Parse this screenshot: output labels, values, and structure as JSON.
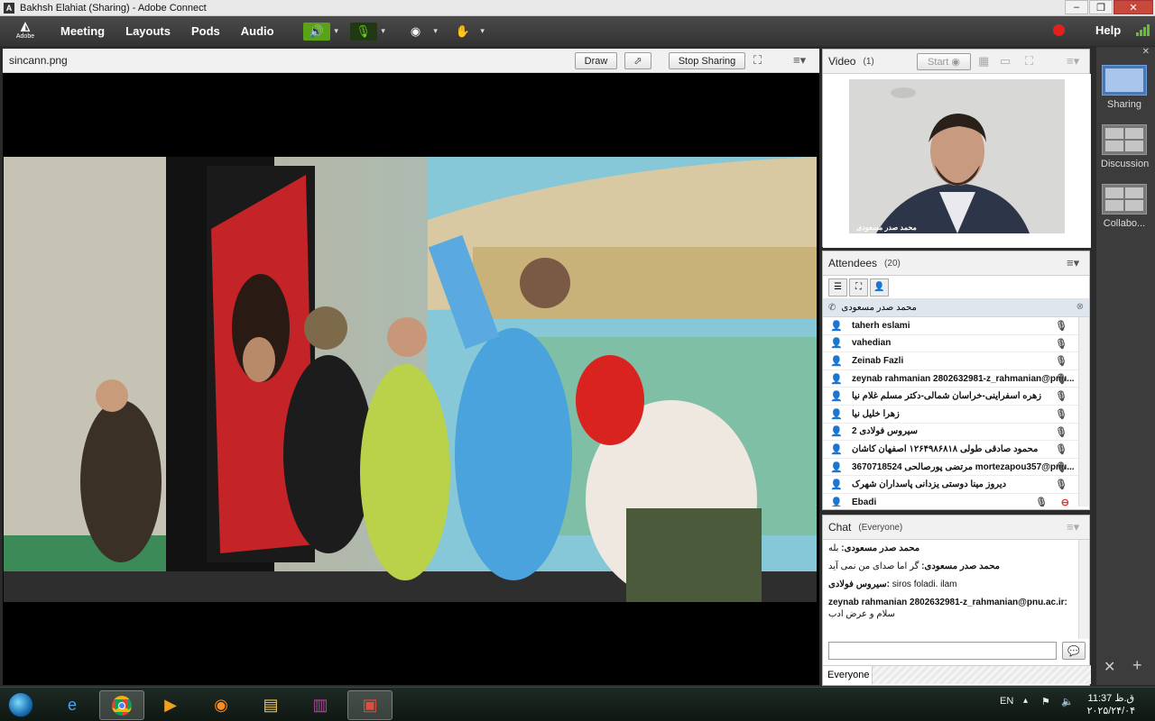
{
  "window": {
    "title": "Bakhsh Elahiat (Sharing) - Adobe Connect",
    "controls": [
      "–",
      "❐",
      "✕"
    ]
  },
  "menubar": {
    "logo": "Adobe",
    "items": [
      "Meeting",
      "Layouts",
      "Pods",
      "Audio"
    ],
    "help": "Help",
    "accent": "#6bd11f"
  },
  "share_pod": {
    "title": "sincann.png",
    "draw_label": "Draw",
    "stop_sharing_label": "Stop Sharing",
    "menu_icon": "≡▾"
  },
  "video_pod": {
    "title": "Video",
    "count": "(1)",
    "start_label": "Start",
    "name_tag": "محمد صدر مسعودی"
  },
  "attendees_pod": {
    "title": "Attendees",
    "count": "(20)",
    "host": "محمد صدر مسعودی",
    "rows": [
      "taherh eslami",
      "vahedian",
      "Zeinab Fazli",
      "zeynab rahmanian 2802632981-z_rahmanian@pnu...",
      "زهره اسفراینی-خراسان شمالی-دکتر مسلم غلام نیا",
      "زهرا خلیل نیا",
      "2 سیروس فولادی",
      "محمود صادقی طولی ۱۲۶۴۹۸۶۸۱۸ اصفهان کاشان",
      "مرتضی پورصالحی 3670718524 mortezapou357@pnu...",
      "دیروز مینا دوستی یزدانی پاسداران شهرک",
      "Ebadi"
    ]
  },
  "chat_pod": {
    "title": "Chat",
    "scope": "(Everyone)",
    "messages": [
      {
        "sender": "محمد صدر مسعودی:",
        "text": "بله"
      },
      {
        "sender": "محمد صدر مسعودی:",
        "text": "گر اما صدای من نمی آید"
      },
      {
        "sender": "سیروس فولادی:",
        "text": "siros foladi. ilam"
      },
      {
        "sender": "zeynab rahmanian 2802632981-z_rahmanian@pnu.ac.ir:",
        "text": "سلام و عرض ادب"
      }
    ],
    "input_value": "",
    "recipient": "Everyone"
  },
  "layouts": [
    {
      "label": "Sharing",
      "active": true
    },
    {
      "label": "Discussion",
      "active": false
    },
    {
      "label": "Collabo...",
      "active": false
    }
  ],
  "taskbar": {
    "lang": "EN",
    "time": "11:37 ق.ظ",
    "date": "۲۰۲۵/۲۴/۰۴",
    "apps": [
      "ie-icon",
      "chrome-icon",
      "media-player-icon",
      "firefox-icon",
      "file-explorer-icon",
      "winrar-icon",
      "adobe-connect-icon"
    ]
  }
}
